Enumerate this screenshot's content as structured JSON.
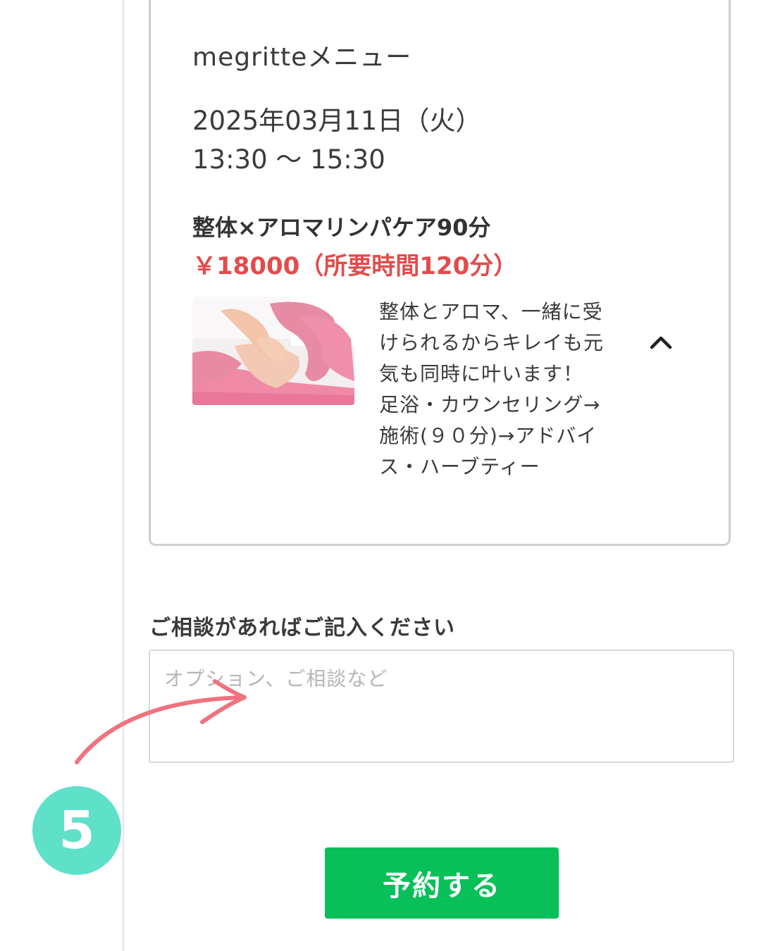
{
  "menu_card": {
    "shop_menu_title": "megritteメニュー",
    "date": "2025年03月11日（火）",
    "time": "13:30 〜 15:30",
    "course": {
      "name": "整体×アロマリンパケア90分",
      "price": "￥18000（所要時間120分）",
      "description_lines": [
        "整体とアロマ、一緒に受",
        "けられるからキレイも元",
        "気も同時に叶います！",
        "足浴・カウンセリング→",
        "施術(９０分)→アドバイ",
        "ス・ハーブティー"
      ],
      "photo_icon": "massage-photo",
      "toggle_icon": "chevron-up-icon"
    }
  },
  "consult": {
    "label": "ご相談があればご記入ください",
    "placeholder": "オプション、ご相談など",
    "value": ""
  },
  "annotation": {
    "step_number": "5",
    "step_color": "#5fe0c9",
    "arrow_color": "#f0727f"
  },
  "reserve_button": {
    "label": "予約する",
    "color": "#07c05a"
  },
  "colors": {
    "price": "#e34b4b",
    "border": "#cfcfcf"
  }
}
